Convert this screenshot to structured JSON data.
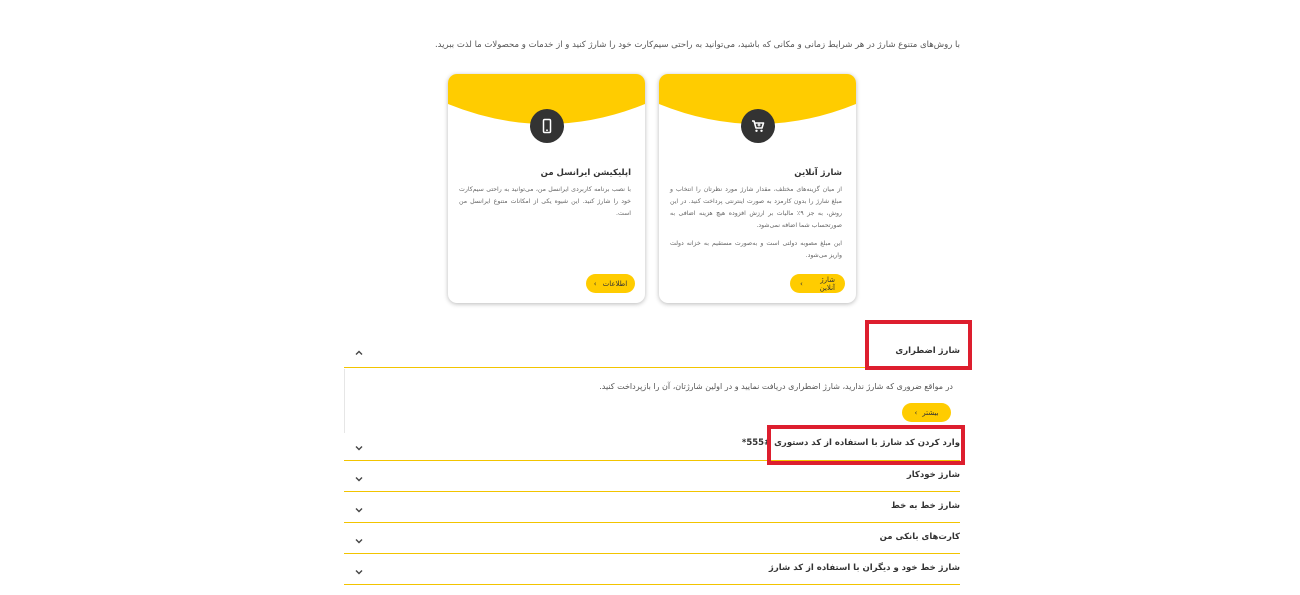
{
  "intro_text": "با روش‌های متنوع شارژ در هر شرایط زمانی و مکانی که باشید، می‌توانید به راحتی سیم‌کارت خود را شارژ کنید و از خدمات و محصولات ما لذت ببرید.",
  "cards": [
    {
      "icon": "cart-icon",
      "title": "شارژ آنلاین",
      "text_1": "از میان گزینه‌های مختلف، مقدار شارژ مورد نظرتان را انتخاب و مبلغ شارژ را بدون کارمزد به صورت اینترنتی پرداخت کنید. در این روش، به جز ۹٪ مالیات بر ارزش افزوده هیچ هزینه اضافی به صورتحساب شما اضافه نمی‌شود.",
      "text_2": "این مبلغ مصوبه دولتی است و به‌صورت مستقیم به خزانه دولت واریز می‌شود.",
      "button": "شارژ آنلاین"
    },
    {
      "icon": "mobile-phone-icon",
      "title": "اپلیکیشن ایرانسل من",
      "text_1": "با نصب برنامه کاربردی ایرانسل من، می‌توانید به راحتی سیم‌کارت خود را شارژ کنید. این شیوه یکی از امکانات متنوع ایرانسل من است.",
      "button": "اطلاعات"
    }
  ],
  "accordion": [
    {
      "title": "شارژ اضطراری",
      "expanded": true,
      "description": "در مواقع ضروری که شارژ ندارید، شارژ اضطراری دریافت نمایید و در اولین شارژتان، آن را بازپرداخت کنید.",
      "button": "بیشتر"
    },
    {
      "title": "وارد کردن کد شارژ با استفاده از کد دستوری ‎*555#",
      "expanded": false
    },
    {
      "title": "شارژ خودکار",
      "expanded": false
    },
    {
      "title": "شارژ خط به خط",
      "expanded": false
    },
    {
      "title": "کارت‌های بانکی من",
      "expanded": false
    },
    {
      "title": "شارژ خط خود و دیگران با استفاده از کد شارژ",
      "expanded": false
    }
  ],
  "colors": {
    "accent": "#ffcc00",
    "highlight": "#dd1e2e",
    "icon_circle": "#333333"
  }
}
